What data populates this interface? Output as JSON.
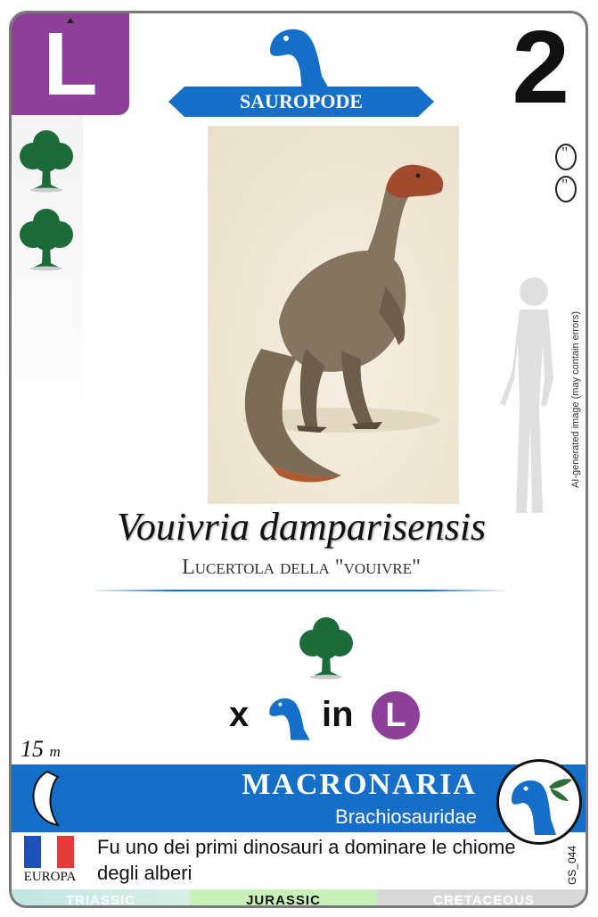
{
  "card": {
    "category_letter": "L",
    "card_number": "2",
    "group_label": "SAUROPODE",
    "scientific_name": "Vouivria damparisensis",
    "common_name": "Lucertola della \"vouivre\"",
    "ai_note": "AI-generated image (may contain errors)",
    "length_value": "15",
    "length_unit": "m",
    "clade": "MACRONARIA",
    "family": "Brachiosauridae",
    "continent": "EUROPA",
    "description": "Fu uno dei primi dinosauri a dominare le chiome degli alberi",
    "code": "GS_044",
    "formula": {
      "times": "x",
      "in": "in",
      "letter": "L"
    },
    "periods": [
      {
        "label": "TRIASSIC",
        "active": false
      },
      {
        "label": "JURASSIC",
        "active": true
      },
      {
        "label": "CRETACEOUS",
        "active": false
      }
    ],
    "side_tree_icons": 2,
    "egg_icons": 2
  },
  "colors": {
    "purple": "#8e3f98",
    "blue": "#156ec8",
    "tree_green": "#1e6b3a",
    "jurassic_green": "#c8f0b8",
    "triassic_teal": "#bfe6e2",
    "cretaceous_gray": "#d9d9d9",
    "flag_blue": "#1f4fb8",
    "flag_red": "#e33a3a"
  },
  "icons": {
    "habitat": "tree-icon",
    "group": "sauropod-head-icon",
    "clade": "sauropod-leaf-icon",
    "eggs": "egg-icon",
    "claw": "claw-icon",
    "human": "human-silhouette-icon"
  }
}
